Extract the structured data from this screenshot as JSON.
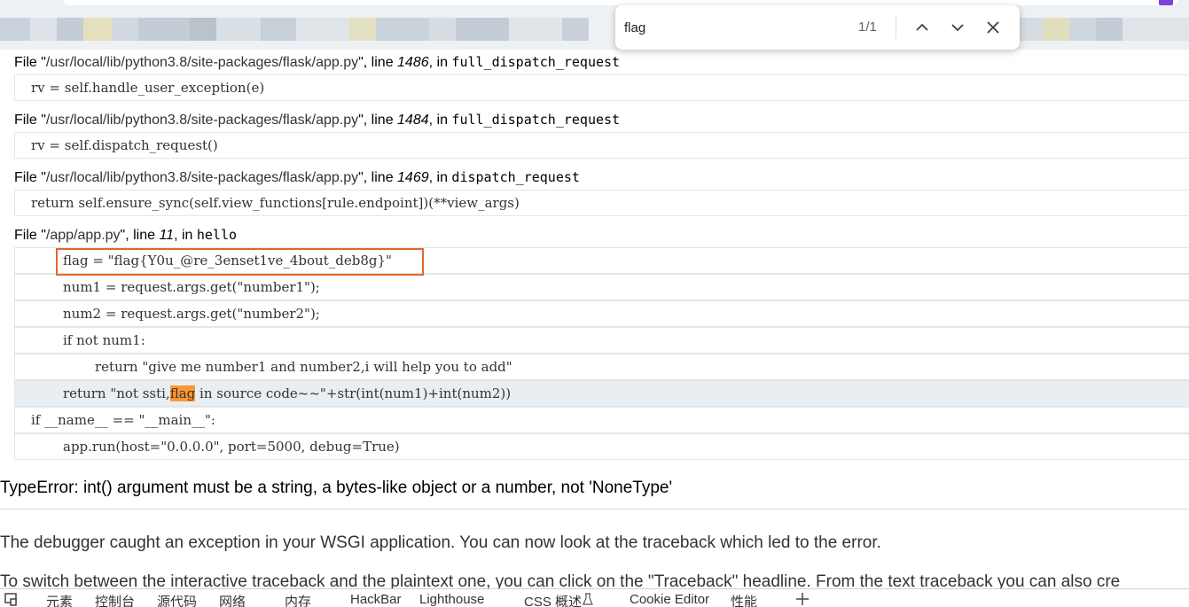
{
  "find_bar": {
    "query": "flag",
    "count": "1/1",
    "prev_icon": "chevron-up-icon",
    "next_icon": "chevron-down-icon",
    "close_icon": "close-icon"
  },
  "frames": [
    {
      "file_prefix": "File \"",
      "file": "/usr/local/lib/python3.8/site-packages/flask/app.py",
      "line_word": "\", line ",
      "line": "1486",
      "in_word": ", in ",
      "func": "full_dispatch_request",
      "code": "rv = self.handle_user_exception(e)"
    },
    {
      "file_prefix": "File \"",
      "file": "/usr/local/lib/python3.8/site-packages/flask/app.py",
      "line_word": "\", line ",
      "line": "1484",
      "in_word": ", in ",
      "func": "full_dispatch_request",
      "code": "rv = self.dispatch_request()"
    },
    {
      "file_prefix": "File \"",
      "file": "/usr/local/lib/python3.8/site-packages/flask/app.py",
      "line_word": "\", line ",
      "line": "1469",
      "in_word": ", in ",
      "func": "dispatch_request",
      "code": "return self.ensure_sync(self.view_functions[rule.endpoint])(**view_args)"
    },
    {
      "file_prefix": "File \"",
      "file": "/app/app.py",
      "line_word": "\", line ",
      "line": "11",
      "in_word": ", in ",
      "func": "hello"
    }
  ],
  "source_lines": [
    "flag = \"flag{Y0u_@re_3enset1ve_4bout_deb8g}\"",
    "num1 = request.args.get(\"number1\");",
    "num2 = request.args.get(\"number2\");",
    "if not num1:",
    "return \"give me number1 and number2,i will help you to add\"",
    "return \"not ssti,",
    "if __name__ == \"__main__\":",
    "app.run(host=\"0.0.0.0\", port=5000, debug=True)"
  ],
  "current_line": {
    "match": "flag",
    "rest": " in source code~~\"+str(int(num1)+int(num2))"
  },
  "error_message": "TypeError: int() argument must be a string, a bytes-like object or a number, not 'NoneType'",
  "explanation": "The debugger caught an exception in your WSGI application. You can now look at the traceback which led to the error.",
  "explanation2": "To switch between the interactive traceback and the plaintext one, you can click on the \"Traceback\" headline. From the text traceback you can also cre",
  "devtools_tabs": [
    "元素",
    "控制台",
    "源代码",
    "网络",
    "内存",
    "HackBar",
    "Lighthouse",
    "CSS 概述",
    "Cookie Editor",
    "性能"
  ],
  "colors": {
    "highlight_box": "#e0682b",
    "find_match": "#ff9632",
    "current_line_bg": "#e8eef2"
  }
}
